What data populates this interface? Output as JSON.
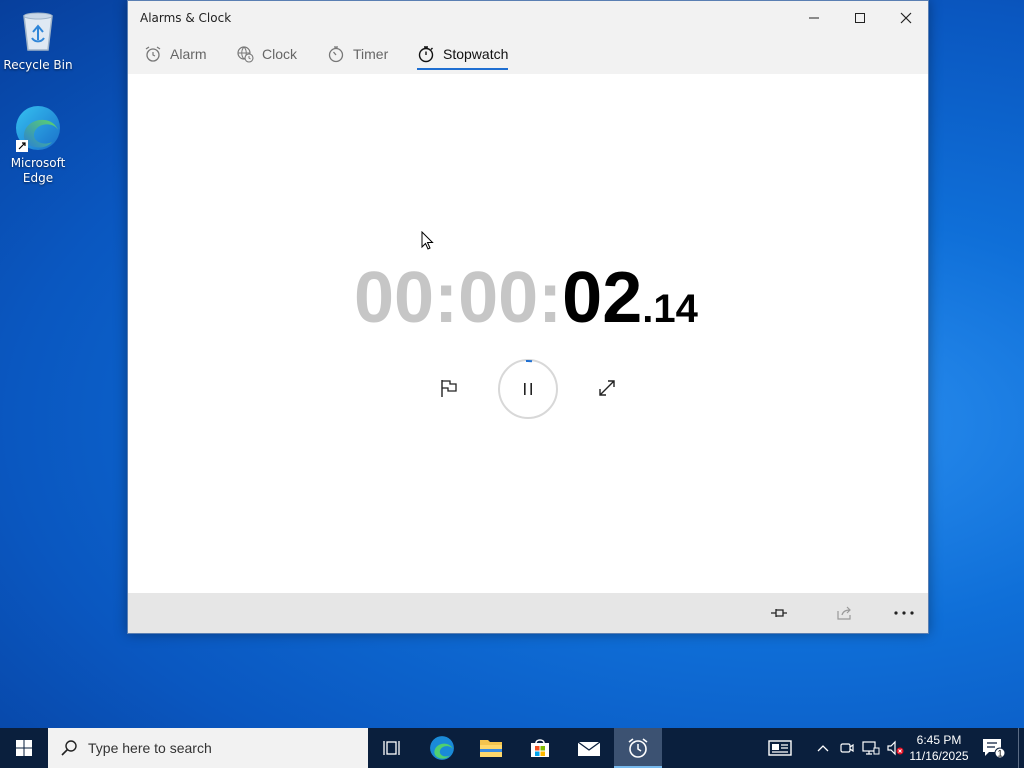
{
  "desktop": {
    "icons": [
      {
        "label": "Recycle Bin",
        "icon": "recycle-bin-icon"
      },
      {
        "label": "Microsoft Edge",
        "icon": "edge-icon"
      }
    ]
  },
  "window": {
    "title": "Alarms & Clock",
    "tabs": [
      {
        "label": "Alarm",
        "icon": "alarm-icon"
      },
      {
        "label": "Clock",
        "icon": "globe-clock-icon"
      },
      {
        "label": "Timer",
        "icon": "timer-icon"
      },
      {
        "label": "Stopwatch",
        "icon": "stopwatch-icon",
        "active": true
      }
    ],
    "stopwatch": {
      "hours": "00",
      "sep1": ":",
      "minutes": "00",
      "sep2": ":",
      "seconds": "02",
      "fraction": ".14"
    },
    "accent": "#1f6fd1"
  },
  "taskbar": {
    "search_placeholder": "Type here to search",
    "time": "6:45 PM",
    "date": "11/16/2025",
    "notification_count": "1"
  }
}
